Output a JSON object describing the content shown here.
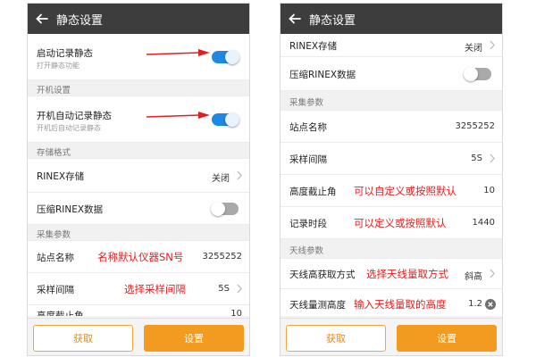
{
  "colors": {
    "app_bar": "#3d3d3d",
    "toggle_on": "#1e88e5",
    "toggle_off": "#a9a9a9",
    "button_orange": "#f39a21",
    "annotation_red": "#e02020"
  },
  "left": {
    "appbar": {
      "title": "静态设置",
      "back_icon": "arrow-left-icon"
    },
    "rows": {
      "static_record": {
        "label": "启动记录静态",
        "sub": "打开静态功能",
        "toggle": "on"
      },
      "boot_header": "开机设置",
      "boot_auto": {
        "label": "开机自动记录静态",
        "sub": "开机后自动记录静态",
        "toggle": "on"
      },
      "storage_header": "存储格式",
      "rinex_storage": {
        "label": "RINEX存储",
        "value": "关闭"
      },
      "compress_rinex": {
        "label": "压缩RINEX数据",
        "toggle": "off"
      },
      "collect_header": "采集参数",
      "site_name": {
        "label": "站点名称",
        "value": "3255252"
      },
      "sample_interval": {
        "label": "采样间隔",
        "value": "5S"
      },
      "elevation_mask": {
        "label": "高度截止角",
        "value": "10"
      }
    },
    "annotations": {
      "site_note": "名称默认仪器SN号",
      "interval_note": "选择采样间隔"
    },
    "buttons": {
      "fetch": "获取",
      "set": "设置"
    }
  },
  "right": {
    "appbar": {
      "title": "静态设置",
      "back_icon": "arrow-left-icon"
    },
    "rows": {
      "rinex_storage": {
        "label": "RINEX存储",
        "value": "关闭"
      },
      "compress_rinex": {
        "label": "压缩RINEX数据",
        "toggle": "off"
      },
      "collect_header": "采集参数",
      "site_name": {
        "label": "站点名称",
        "value": "3255252"
      },
      "sample_interval": {
        "label": "采样间隔",
        "value": "5S"
      },
      "elevation_mask": {
        "label": "高度截止角",
        "value": "10"
      },
      "record_period": {
        "label": "记录时段",
        "value": "1440"
      },
      "antenna_header": "天线参数",
      "antenna_method": {
        "label": "天线高获取方式",
        "value": "斜高"
      },
      "antenna_measure": {
        "label": "天线量测高度",
        "value": "1.2"
      }
    },
    "annotations": {
      "elevation_note": "可以自定义或按照默认",
      "period_note": "可以定义或按照默认",
      "method_note": "选择天线量取方式",
      "measure_note": "输入天线量取的高度"
    },
    "buttons": {
      "fetch": "获取",
      "set": "设置"
    }
  }
}
